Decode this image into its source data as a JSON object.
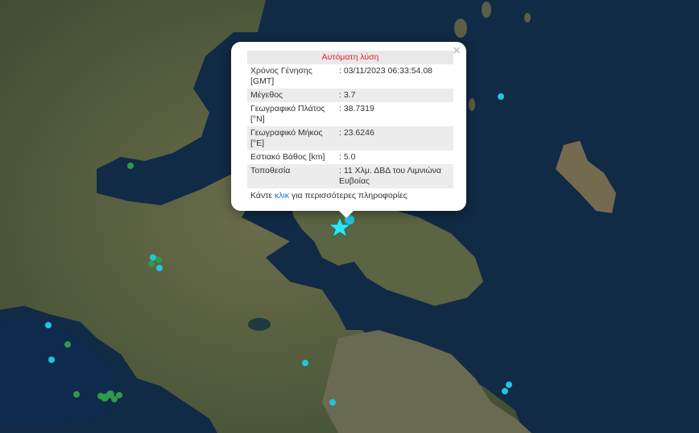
{
  "popup": {
    "title": "Αυτόματη λύση",
    "close_symbol": "×",
    "rows": [
      {
        "label": "Χρόνος Γένησης [GMT]",
        "value": ": 03/11/2023 06:33:54.08"
      },
      {
        "label": "Μέγεθος",
        "value": ": 3.7"
      },
      {
        "label": "Γεωγραφικό Πλάτος [°N]",
        "value": ": 38.7319"
      },
      {
        "label": "Γεωγραφικό Μήκος [°E]",
        "value": ": 23.6246"
      },
      {
        "label": "Εστιακό Βάθος [km]",
        "value": ": 5.0"
      },
      {
        "label": "Τοποθεσία",
        "value": ": 11 Χλμ. ΔΒΔ του Λιμνιώνα Ευβοίας"
      }
    ],
    "more_prefix": "Κάντε",
    "more_link": "κλικ",
    "more_suffix": "για περισσότερες πληροφορίες"
  },
  "colors": {
    "sea": "#0f2742",
    "land": "#55603f",
    "cyan_marker": "#22c4de",
    "green_marker": "#2f9a4a",
    "star": "#2ee6f2",
    "title_red": "#e8202a",
    "link_blue": "#1a73c8"
  },
  "icons": {
    "main_event": "star-icon",
    "events": "circle-icon"
  }
}
